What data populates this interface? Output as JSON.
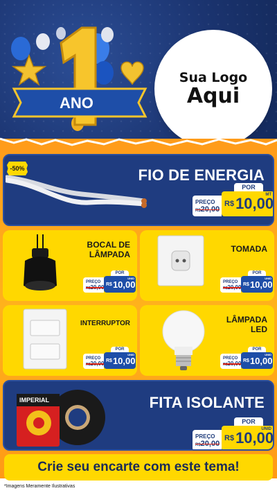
{
  "header": {
    "anniversary_number": "1",
    "anniversary_word": "ANO",
    "logo_line1": "Sua Logo",
    "logo_line2": "Aqui"
  },
  "featured_top": {
    "title": "FIO DE ENERGIA",
    "badge": "-50%",
    "price_label": "PREÇO",
    "old_price": "20,00",
    "old_prefix": "R$",
    "por_label": "POR",
    "currency": "R$",
    "new_price": "10,00",
    "unit": "MT"
  },
  "grid": [
    {
      "title_lines": [
        "BOCAL DE",
        "LÂMPADA"
      ],
      "price_label": "PREÇO",
      "old_prefix": "R$",
      "old_price": "20,00",
      "por_label": "POR",
      "currency": "R$",
      "new_price": "10,00",
      "unit": "UNID"
    },
    {
      "title_lines": [
        "TOMADA"
      ],
      "price_label": "PREÇO",
      "old_prefix": "R$",
      "old_price": "20,00",
      "por_label": "POR",
      "currency": "R$",
      "new_price": "10,00",
      "unit": "UNID"
    },
    {
      "title_lines": [
        "INTERRUPTOR"
      ],
      "price_label": "PREÇO",
      "old_prefix": "R$",
      "old_price": "20,00",
      "por_label": "POR",
      "currency": "R$",
      "new_price": "10,00",
      "unit": "UNID"
    },
    {
      "title_lines": [
        "LÂMPADA",
        "LED"
      ],
      "price_label": "PREÇO",
      "old_prefix": "R$",
      "old_price": "20,00",
      "por_label": "POR",
      "currency": "R$",
      "new_price": "10,00",
      "unit": "UNID"
    }
  ],
  "featured_bottom": {
    "title": "FITA ISOLANTE",
    "product_brand": "IMPERIAL",
    "price_label": "PREÇO",
    "old_prefix": "R$",
    "old_price": "20,00",
    "por_label": "POR",
    "currency": "R$",
    "new_price": "10,00",
    "unit": "UNID"
  },
  "cta": "Crie seu encarte com este tema!",
  "footnote": "*Imagens Meramente Ilustrativas",
  "colors": {
    "navy": "#1f3c80",
    "yellow": "#ffd800",
    "orange": "#ff9c1a",
    "price_blue": "#1e4ea8"
  }
}
